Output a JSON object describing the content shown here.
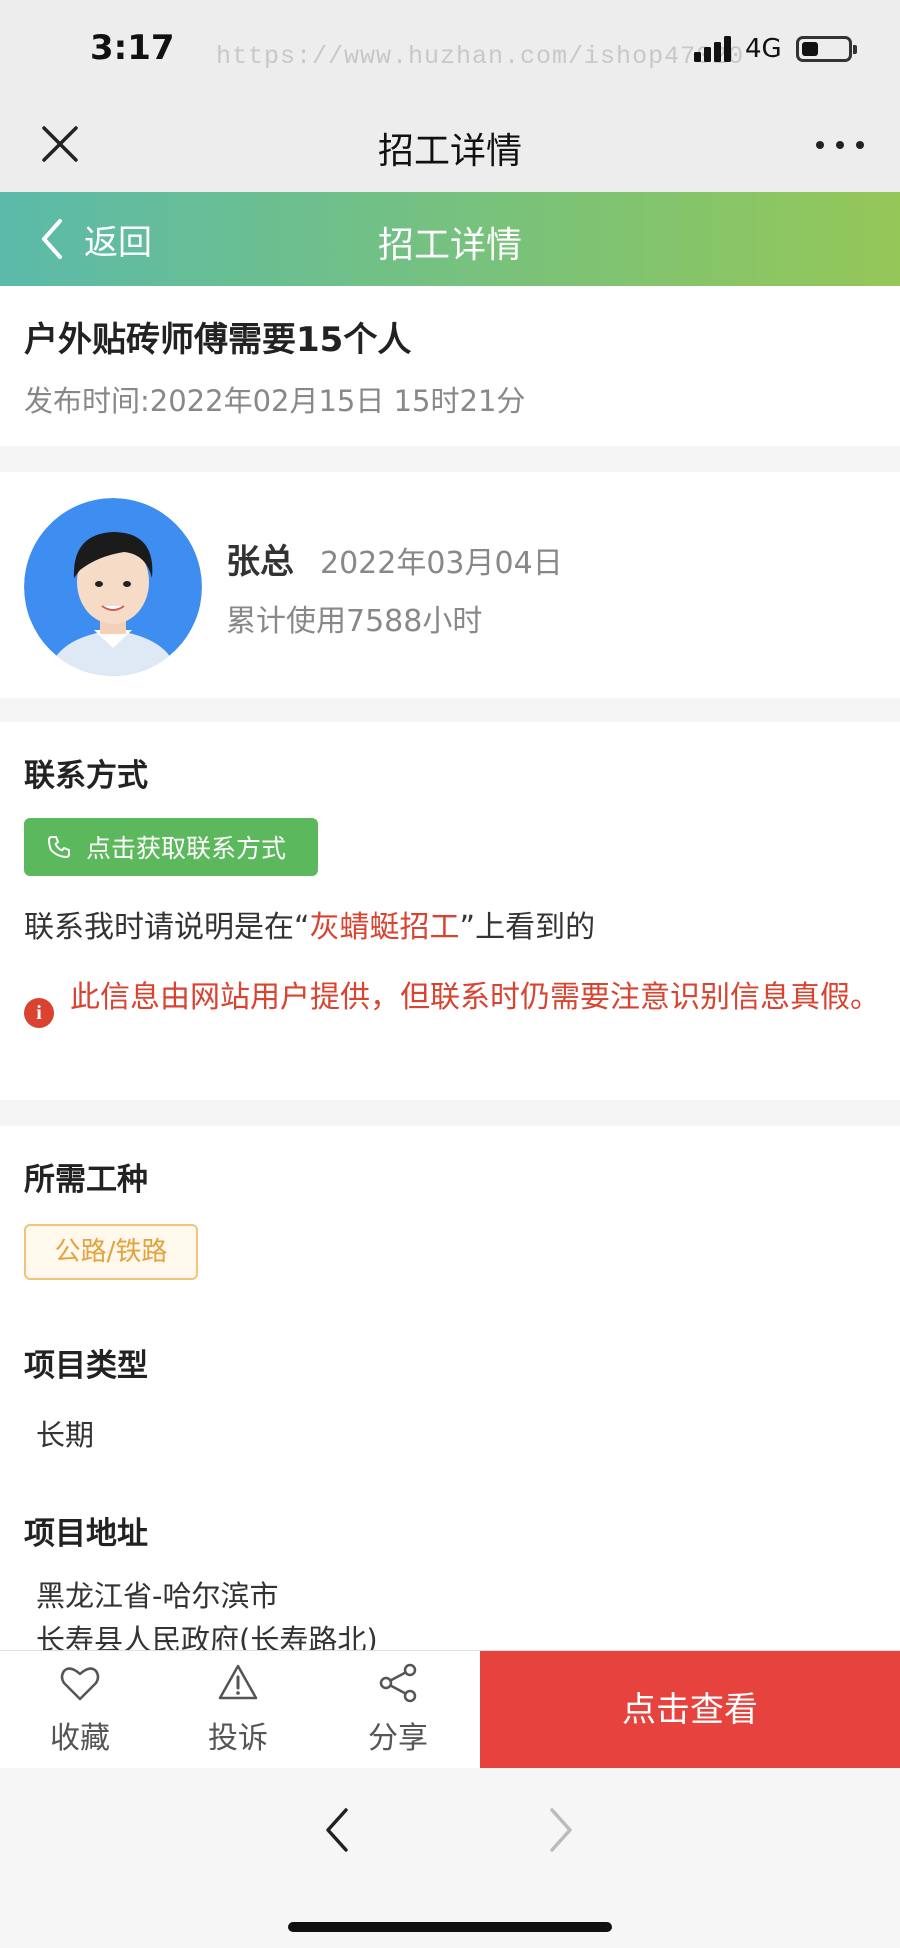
{
  "status": {
    "time": "3:17",
    "watermark": "https://www.huzhan.com/ishop47020",
    "network": "4G"
  },
  "wechat": {
    "title": "招工详情"
  },
  "header": {
    "back_label": "返回",
    "title": "招工详情",
    "gradient_colors": [
      "#5bbaaa",
      "#95c758"
    ]
  },
  "job": {
    "title": "户外贴砖师傅需要15个人",
    "publish_time": "发布时间:2022年02月15日 15时21分"
  },
  "poster": {
    "name": "张总",
    "date": "2022年03月04日",
    "usage": "累计使用7588小时"
  },
  "contact": {
    "section_title": "联系方式",
    "button_label": "点击获取联系方式",
    "note_prefix": "联系我时请说明是在“",
    "note_highlight": "灰蜻蜓招工",
    "note_suffix": "”上看到的",
    "warning": "此信息由网站用户提供，但联系时仍需要注意识别信息真假。"
  },
  "details": {
    "trade_title": "所需工种",
    "trade_tag": "公路/铁路",
    "type_title": "项目类型",
    "type_value": "长期",
    "address_title": "项目地址",
    "address_line1": "黑龙江省-哈尔滨市",
    "address_line2": "长寿县人民政府(长寿路北)"
  },
  "actions": {
    "favorite": "收藏",
    "report": "投诉",
    "share": "分享",
    "view": "点击查看"
  },
  "colors": {
    "accent_red": "#e6433e",
    "warning_red": "#d9432f",
    "contact_green": "#5cb85c",
    "tag_orange": "#e3a23c"
  }
}
